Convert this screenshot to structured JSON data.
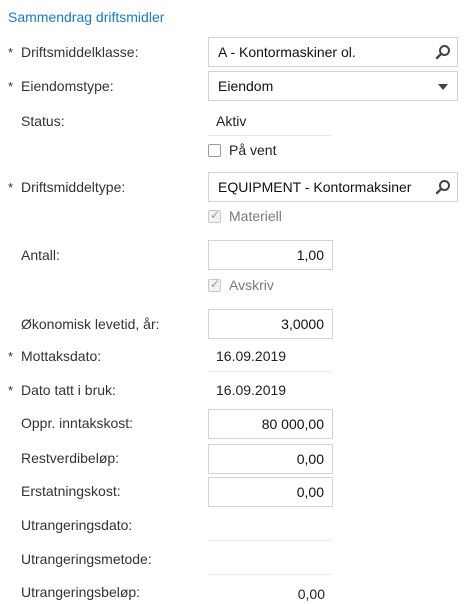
{
  "section_title": "Sammendrag driftsmidler",
  "required_marker": "*",
  "fields": {
    "asset_class": {
      "label": "Driftsmiddelklasse:",
      "value": "A - Kontormaskiner ol."
    },
    "property_type": {
      "label": "Eiendomstype:",
      "value": "Eiendom"
    },
    "status": {
      "label": "Status:",
      "value": "Aktiv"
    },
    "on_hold": {
      "label": "På vent",
      "checked": false
    },
    "asset_type": {
      "label": "Driftsmiddeltype:",
      "value": "EQUIPMENT - Kontormaksiner"
    },
    "tangible": {
      "label": "Materiell",
      "checked": true
    },
    "quantity": {
      "label": "Antall:",
      "value": "1,00"
    },
    "depreciate": {
      "label": "Avskriv",
      "checked": true
    },
    "useful_life": {
      "label": "Økonomisk levetid, år:",
      "value": "3,0000"
    },
    "receipt_date": {
      "label": "Mottaksdato:",
      "value": "16.09.2019"
    },
    "placed_in_service": {
      "label": "Dato tatt i bruk:",
      "value": "16.09.2019"
    },
    "orig_acq_cost": {
      "label": "Oppr. inntakskost:",
      "value": "80 000,00"
    },
    "salvage_amount": {
      "label": "Restverdibeløp:",
      "value": "0,00"
    },
    "replacement_cost": {
      "label": "Erstatningskost:",
      "value": "0,00"
    },
    "disposal_date": {
      "label": "Utrangeringsdato:",
      "value": ""
    },
    "disposal_method": {
      "label": "Utrangeringsmetode:",
      "value": ""
    },
    "disposal_amount": {
      "label": "Utrangeringsbeløp:",
      "value": "0,00"
    }
  },
  "icons": {
    "lookup": "search-icon",
    "dropdown": "caret-down-icon",
    "check": "checkmark-icon"
  },
  "colors": {
    "accent": "#1a7bbf",
    "border": "#d2d2d2"
  }
}
